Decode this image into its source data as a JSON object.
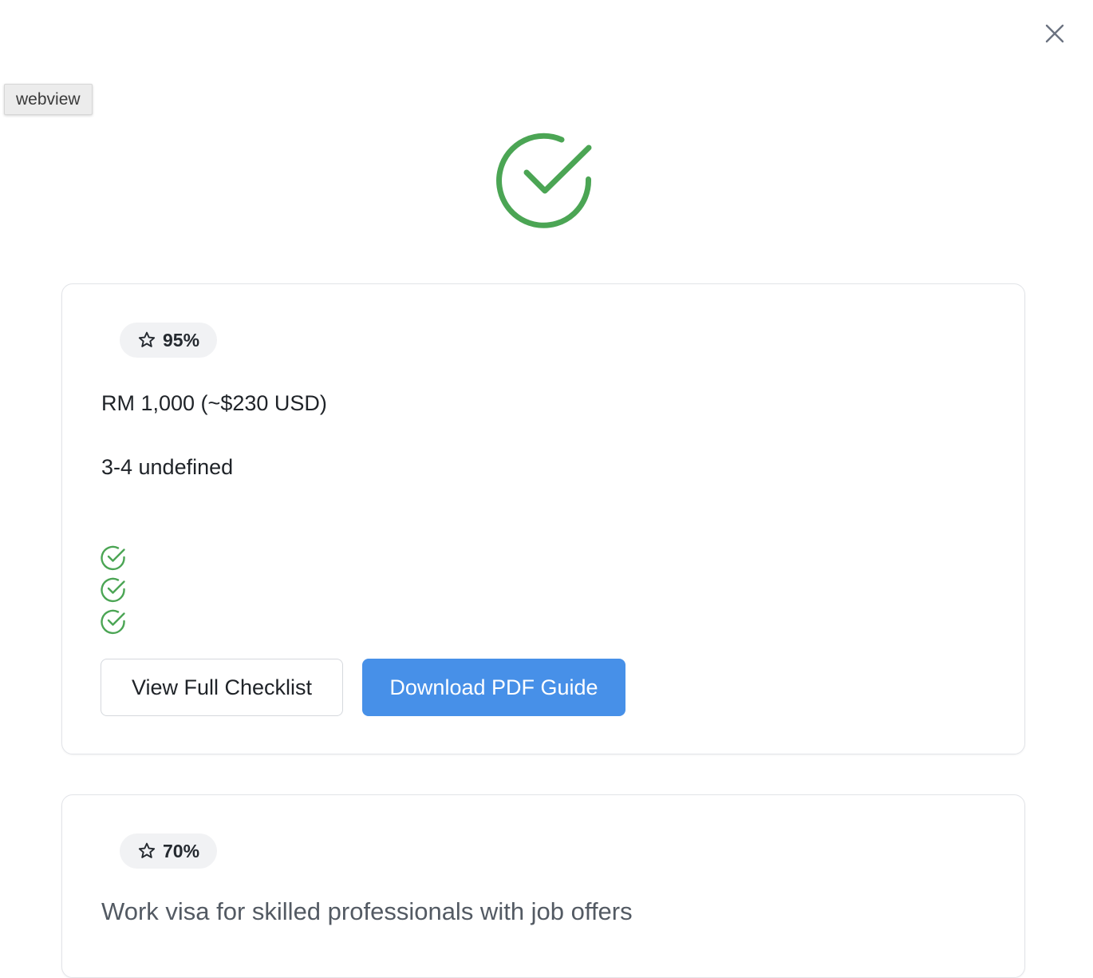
{
  "overlay": {
    "webview_label": "webview"
  },
  "icons": {
    "close": "close-icon",
    "hero": "check-circle-icon",
    "badge": "star-outline-icon",
    "list": "check-circle-small-icon"
  },
  "colors": {
    "success_green": "#4ba554",
    "primary_blue": "#4790e8",
    "badge_bg": "#f1f2f4"
  },
  "cards": [
    {
      "match": "95%",
      "price": "RM 1,000 (~$230 USD)",
      "duration": "3-4 undefined",
      "checklist_count": 3,
      "actions": {
        "secondary": "View Full Checklist",
        "primary": "Download PDF Guide"
      }
    },
    {
      "match": "70%",
      "description": "Work visa for skilled professionals with job offers"
    }
  ]
}
